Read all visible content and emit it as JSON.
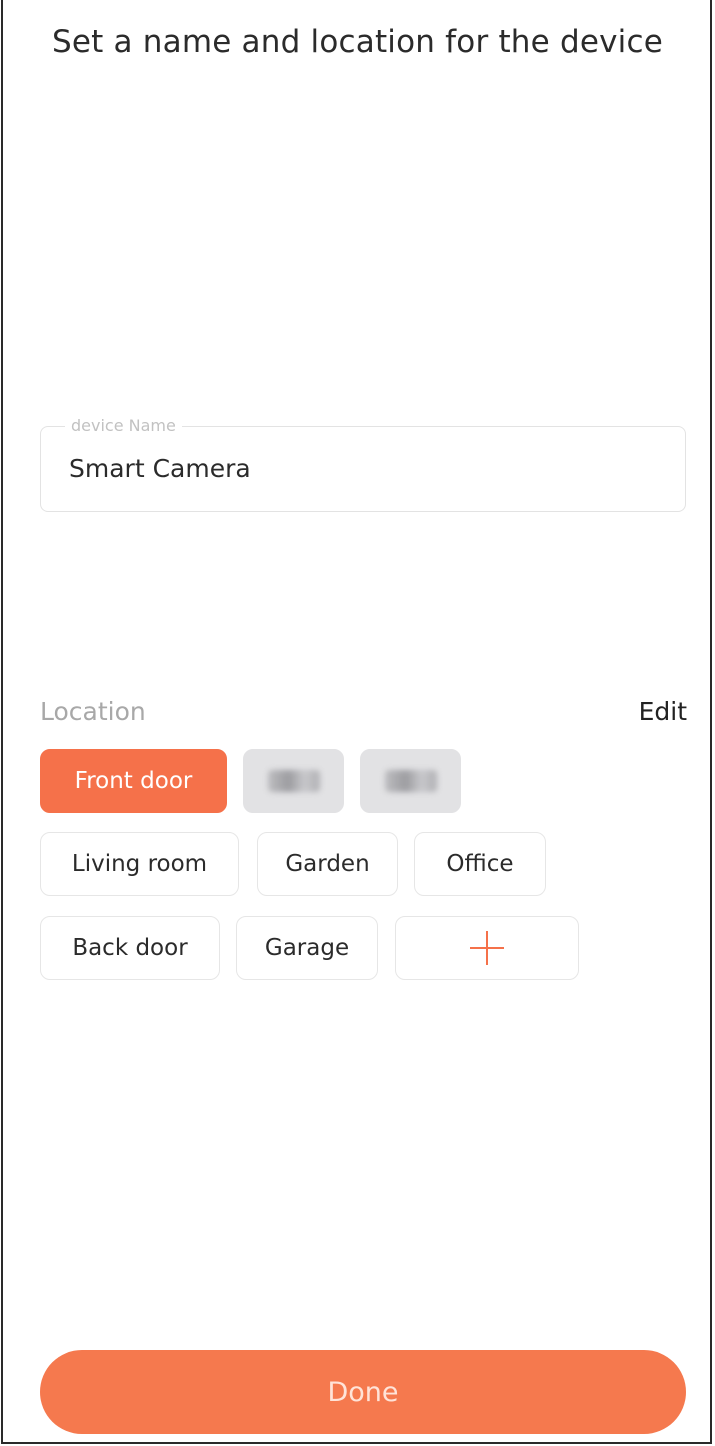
{
  "header": {
    "title": "Set a name and location for the device"
  },
  "device_name": {
    "label": "device Name",
    "value": "Smart Camera"
  },
  "location": {
    "label": "Location",
    "edit_label": "Edit",
    "chips": [
      {
        "label": "Front door",
        "selected": true
      },
      {
        "label": "",
        "redacted": true
      },
      {
        "label": "",
        "redacted": true
      },
      {
        "label": "Living room"
      },
      {
        "label": "Garden"
      },
      {
        "label": "Office"
      },
      {
        "label": "Back door"
      },
      {
        "label": "Garage"
      }
    ],
    "add_icon": "plus-icon"
  },
  "footer": {
    "done_label": "Done"
  },
  "colors": {
    "accent": "#f5714a",
    "chip_border": "#e6e6e6",
    "label_gray": "#a8a8a8"
  }
}
